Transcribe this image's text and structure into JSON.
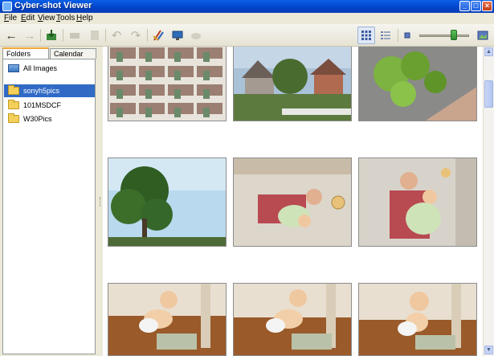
{
  "window": {
    "title": "Cyber-shot Viewer"
  },
  "menu": {
    "items": [
      {
        "acc": "F",
        "rest": "ile"
      },
      {
        "acc": "E",
        "rest": "dit"
      },
      {
        "acc": "V",
        "rest": "iew"
      },
      {
        "acc": "T",
        "rest": "ools"
      },
      {
        "acc": "H",
        "rest": "elp"
      }
    ]
  },
  "toolbar": {
    "back_icon": "←",
    "forward_icon": "→",
    "view_mode": "grid",
    "zoom_level": 0.73
  },
  "sidebar": {
    "tabs": [
      "Folders",
      "Calendar"
    ],
    "active_tab": "Folders",
    "items": [
      {
        "label": "All Images",
        "icon": "all-images-icon"
      },
      {
        "label": "sonyh5pics",
        "icon": "folder-icon",
        "selected": true
      },
      {
        "label": "101MSDCF",
        "icon": "folder-icon"
      },
      {
        "label": "W30Pics",
        "icon": "folder-icon"
      }
    ]
  },
  "colors": {
    "title_bar": "#0144c8",
    "selection": "#316ac5",
    "window_bg": "#ece9d8"
  },
  "thumbnails": [
    {
      "subject": "photo-grid-collage"
    },
    {
      "subject": "backyard-houses"
    },
    {
      "subject": "tree-leaves-roof"
    },
    {
      "subject": "tree-sky"
    },
    {
      "subject": "man-holding-baby-rotated"
    },
    {
      "subject": "man-holding-baby"
    },
    {
      "subject": "baby-crawling-1"
    },
    {
      "subject": "baby-crawling-2"
    },
    {
      "subject": "baby-crawling-3"
    }
  ]
}
